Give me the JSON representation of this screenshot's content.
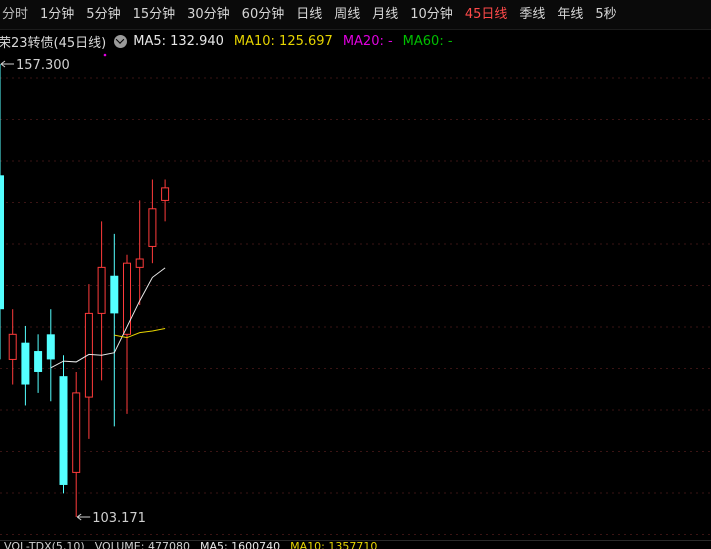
{
  "periods": {
    "items": [
      {
        "label": "分时",
        "active": false
      },
      {
        "label": "1分钟",
        "active": false
      },
      {
        "label": "5分钟",
        "active": false
      },
      {
        "label": "15分钟",
        "active": false
      },
      {
        "label": "30分钟",
        "active": false
      },
      {
        "label": "60分钟",
        "active": false
      },
      {
        "label": "日线",
        "active": false
      },
      {
        "label": "周线",
        "active": false
      },
      {
        "label": "月线",
        "active": false
      },
      {
        "label": "10分钟",
        "active": false
      },
      {
        "label": "45日线",
        "active": true
      },
      {
        "label": "季线",
        "active": false
      },
      {
        "label": "年线",
        "active": false
      },
      {
        "label": "5秒",
        "active": false
      }
    ]
  },
  "legend": {
    "name": "荣23转债(45日线)",
    "ma5": {
      "label": "MA5: 132.940",
      "color": "#e8e8e8"
    },
    "ma10": {
      "label": "MA10: 125.697",
      "color": "#e6d400"
    },
    "ma20": {
      "label": "MA20: -",
      "color": "#e000e0"
    },
    "ma60": {
      "label": "MA60: -",
      "color": "#00c000"
    }
  },
  "chart_data": {
    "type": "candlestick",
    "high_label": "157.300",
    "low_label": "103.171",
    "price_range": [
      103.171,
      157.3
    ],
    "up_color": "#ff3b3b",
    "down_color": "#54ffff",
    "candles": [
      {
        "open": 144.0,
        "close": 128.0,
        "high": 157.3,
        "low": 122.0
      },
      {
        "open": 122.0,
        "close": 125.0,
        "high": 128.0,
        "low": 119.0
      },
      {
        "open": 124.0,
        "close": 119.0,
        "high": 126.0,
        "low": 116.5
      },
      {
        "open": 123.0,
        "close": 120.5,
        "high": 125.0,
        "low": 118.0
      },
      {
        "open": 125.0,
        "close": 122.0,
        "high": 128.0,
        "low": 117.0
      },
      {
        "open": 120.0,
        "close": 107.0,
        "high": 122.5,
        "low": 106.0
      },
      {
        "open": 108.5,
        "close": 118.0,
        "high": 120.5,
        "low": 103.171
      },
      {
        "open": 117.5,
        "close": 127.5,
        "high": 131.0,
        "low": 112.5
      },
      {
        "open": 127.5,
        "close": 133.0,
        "high": 138.5,
        "low": 119.5
      },
      {
        "open": 132.0,
        "close": 127.5,
        "high": 137.0,
        "low": 114.0
      },
      {
        "open": 125.0,
        "close": 133.5,
        "high": 134.5,
        "low": 115.5
      },
      {
        "open": 133.0,
        "close": 134.0,
        "high": 141.0,
        "low": 128.5
      },
      {
        "open": 135.5,
        "close": 140.0,
        "high": 143.5,
        "low": 133.5
      },
      {
        "open": 141.0,
        "close": 142.5,
        "high": 143.5,
        "low": 138.5
      }
    ],
    "ma5": [
      null,
      null,
      null,
      null,
      121.0,
      121.8,
      121.7,
      122.6,
      122.5,
      122.8,
      125.9,
      129.0,
      131.8,
      132.94
    ],
    "ma10": [
      null,
      null,
      null,
      null,
      null,
      null,
      null,
      null,
      null,
      124.9,
      124.6,
      125.2,
      125.4,
      125.697
    ]
  },
  "volume_strip": {
    "title": "VOL-TDX(5,10)",
    "volume": "VOLUME: 477080",
    "ma5": "MA5: 1600740",
    "ma10": "MA10: 1357710"
  }
}
